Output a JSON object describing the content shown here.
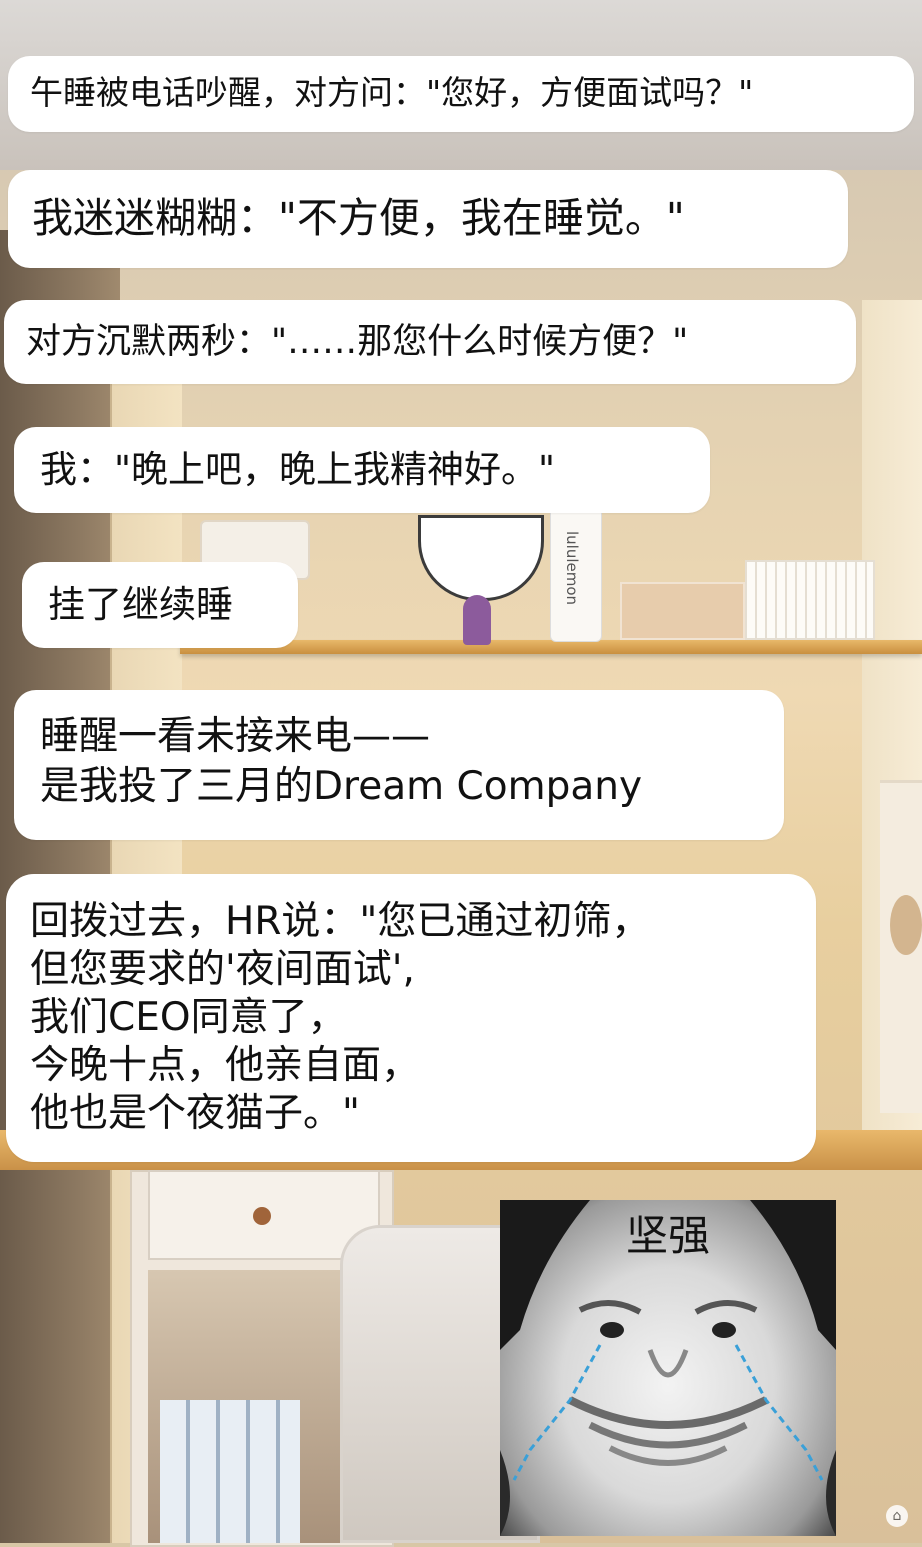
{
  "messages": [
    "午睡被电话吵醒，对方问：\"您好，方便面试吗？\"",
    "我迷迷糊糊：\"不方便，我在睡觉。\"",
    "对方沉默两秒：\"……那您什么时候方便？\"",
    "我：\"晚上吧，晚上我精神好。\"",
    "挂了继续睡",
    [
      "睡醒一看未接来电——",
      "是我投了三月的Dream Company"
    ],
    [
      "回拨过去，HR说：\"您已通过初筛，",
      "但您要求的'夜间面试',",
      "我们CEO同意了，",
      "今晚十点，他亲自面，",
      "他也是个夜猫子。\""
    ]
  ],
  "background": {
    "bottle_brand": "lululemon"
  },
  "meme": {
    "caption": "坚强"
  }
}
